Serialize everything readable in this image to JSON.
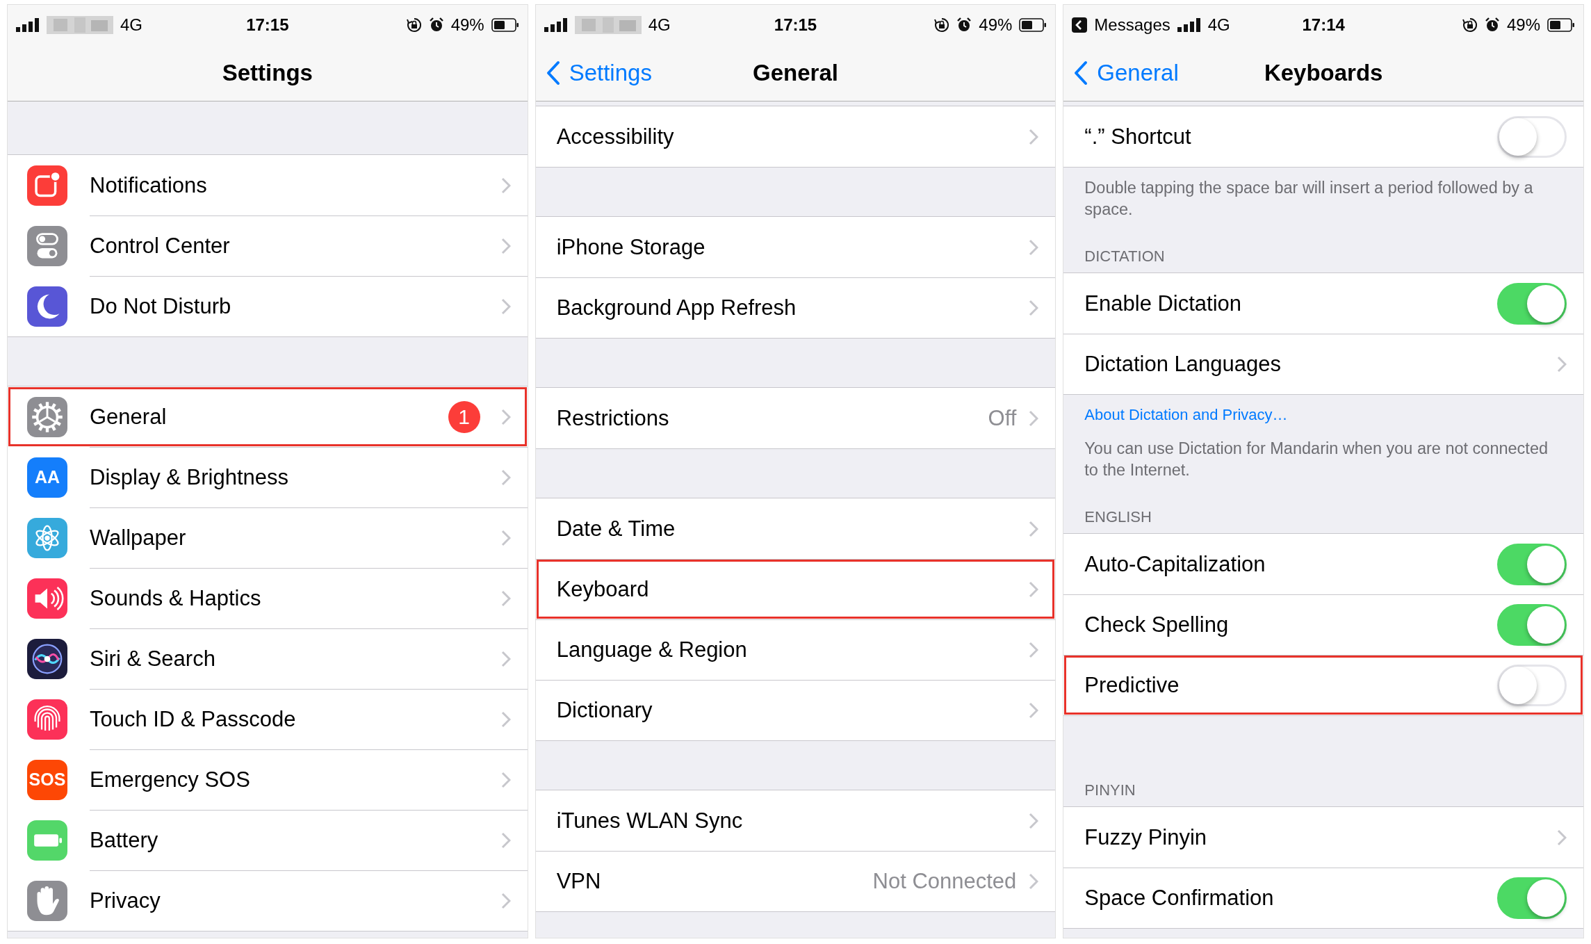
{
  "panels": [
    {
      "status": {
        "network": "4G",
        "time": "17:15",
        "battery": "49%"
      },
      "nav": {
        "title": "Settings"
      },
      "blocks": [
        {
          "kind": "gap"
        },
        {
          "kind": "group",
          "rows": [
            {
              "label": "Notifications",
              "color": "#fc3d39",
              "kind": "chevron",
              "highlighted": false
            },
            {
              "label": "Control Center",
              "color": "#8e8e93",
              "kind": "chevron",
              "highlighted": false
            },
            {
              "label": "Do Not Disturb",
              "color": "#5856d6",
              "kind": "chevron",
              "highlighted": false
            }
          ]
        },
        {
          "kind": "gap"
        },
        {
          "kind": "group",
          "rows": [
            {
              "label": "General",
              "color": "#8e8e93",
              "badge": "1",
              "kind": "chevron",
              "highlighted": true
            },
            {
              "label": "Display & Brightness",
              "color": "#147efb",
              "icon_text": "AA",
              "kind": "chevron",
              "highlighted": false
            },
            {
              "label": "Wallpaper",
              "color": "#36aadc",
              "kind": "chevron",
              "highlighted": false
            },
            {
              "label": "Sounds & Haptics",
              "color": "#fc3158",
              "kind": "chevron",
              "highlighted": false
            },
            {
              "label": "Siri & Search",
              "color": "#1c1c3c",
              "kind": "chevron",
              "highlighted": false
            },
            {
              "label": "Touch ID & Passcode",
              "color": "#fc3158",
              "kind": "chevron",
              "highlighted": false
            },
            {
              "label": "Emergency SOS",
              "color": "#fd4705",
              "icon_text": "SOS",
              "kind": "chevron",
              "highlighted": false
            },
            {
              "label": "Battery",
              "color": "#53d769",
              "kind": "chevron",
              "highlighted": false
            },
            {
              "label": "Privacy",
              "color": "#8e8e93",
              "kind": "chevron",
              "highlighted": false
            }
          ]
        }
      ]
    },
    {
      "status": {
        "network": "4G",
        "time": "17:15",
        "battery": "49%"
      },
      "nav": {
        "back": "Settings",
        "title": "General"
      },
      "blocks": [
        {
          "kind": "group",
          "rows": [
            {
              "label": "Accessibility",
              "kind": "chevron",
              "highlighted": false
            }
          ]
        },
        {
          "kind": "gap"
        },
        {
          "kind": "group",
          "rows": [
            {
              "label": "iPhone Storage",
              "kind": "chevron",
              "highlighted": false
            },
            {
              "label": "Background App Refresh",
              "kind": "chevron",
              "highlighted": false
            }
          ]
        },
        {
          "kind": "gap"
        },
        {
          "kind": "group",
          "rows": [
            {
              "label": "Restrictions",
              "value": "Off",
              "kind": "chevron",
              "highlighted": false
            }
          ]
        },
        {
          "kind": "gap"
        },
        {
          "kind": "group",
          "rows": [
            {
              "label": "Date & Time",
              "kind": "chevron",
              "highlighted": false
            },
            {
              "label": "Keyboard",
              "kind": "chevron",
              "highlighted": true
            },
            {
              "label": "Language & Region",
              "kind": "chevron",
              "highlighted": false
            },
            {
              "label": "Dictionary",
              "kind": "chevron",
              "highlighted": false
            }
          ]
        },
        {
          "kind": "gap"
        },
        {
          "kind": "group",
          "rows": [
            {
              "label": "iTunes WLAN Sync",
              "kind": "chevron",
              "highlighted": false
            },
            {
              "label": "VPN",
              "value": "Not Connected",
              "kind": "chevron",
              "highlighted": false
            }
          ]
        }
      ]
    },
    {
      "status": {
        "back_app": "Messages",
        "network": "4G",
        "time": "17:14",
        "battery": "49%"
      },
      "nav": {
        "back": "General",
        "title": "Keyboards"
      },
      "blocks": [
        {
          "kind": "group",
          "rows": [
            {
              "label": "“.” Shortcut",
              "kind": "switch",
              "on": false,
              "highlighted": false
            }
          ]
        },
        {
          "kind": "footer",
          "text": "Double tapping the space bar will insert a period followed by a space."
        },
        {
          "kind": "header",
          "text": "DICTATION"
        },
        {
          "kind": "group",
          "rows": [
            {
              "label": "Enable Dictation",
              "kind": "switch",
              "on": true,
              "highlighted": false
            },
            {
              "label": "Dictation Languages",
              "kind": "chevron",
              "highlighted": false
            }
          ]
        },
        {
          "kind": "link",
          "text": "About Dictation and Privacy…"
        },
        {
          "kind": "footer",
          "text": "You can use Dictation for Mandarin when you are not connected to the Internet."
        },
        {
          "kind": "header",
          "text": "ENGLISH"
        },
        {
          "kind": "group",
          "rows": [
            {
              "label": "Auto-Capitalization",
              "kind": "switch",
              "on": true,
              "highlighted": false
            },
            {
              "label": "Check Spelling",
              "kind": "switch",
              "on": true,
              "highlighted": false
            },
            {
              "label": "Predictive",
              "kind": "switch",
              "on": false,
              "highlighted": true
            }
          ]
        },
        {
          "kind": "gap"
        },
        {
          "kind": "header",
          "text": "PINYIN"
        },
        {
          "kind": "group",
          "rows": [
            {
              "label": "Fuzzy Pinyin",
              "kind": "chevron",
              "highlighted": false
            },
            {
              "label": "Space Confirmation",
              "kind": "switch",
              "on": true,
              "highlighted": false
            }
          ]
        }
      ]
    }
  ]
}
